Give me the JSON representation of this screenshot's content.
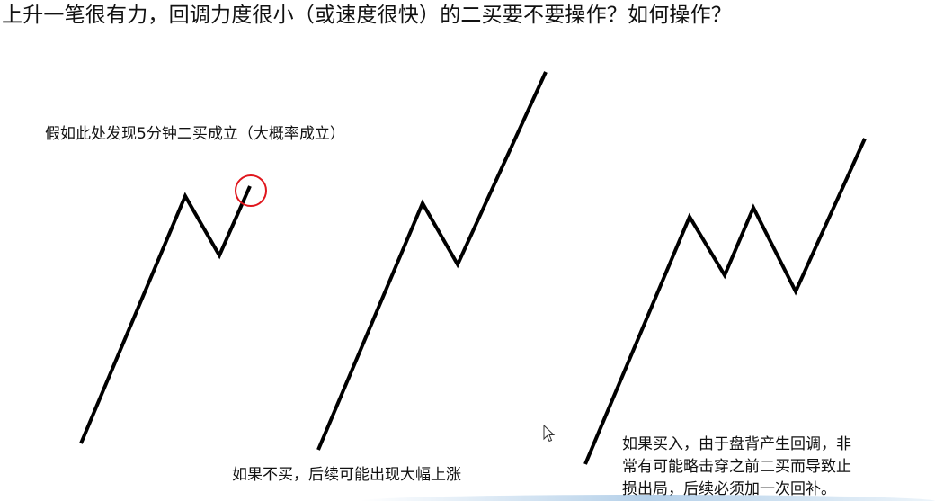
{
  "slide": {
    "title": "上升一笔很有力，回调力度很小（或速度很快）的二买要不要操作？如何操作？"
  },
  "panels": [
    {
      "note": "假如此处发现5分钟二买成立（大概率成立）",
      "highlight_color": "#e0161d"
    },
    {
      "note": "如果不买，后续可能出现大幅上涨"
    },
    {
      "note_lines": [
        "如果买入，由于盘背产生回调，非",
        "常有可能略击穿之前二买而导致止",
        "损出局，后续必须加一次回补。"
      ]
    }
  ],
  "colors": {
    "line": "#000000",
    "highlight": "#e0161d",
    "background": "#ffffff"
  },
  "icons": [
    "mouse-cursor-icon"
  ]
}
